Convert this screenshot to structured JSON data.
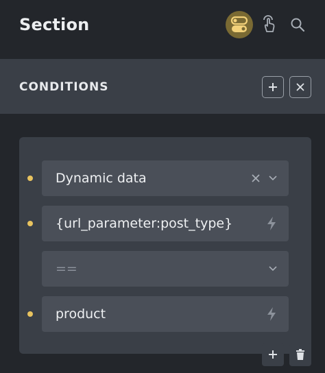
{
  "header": {
    "title": "Section",
    "icons": [
      "toggle-switch-icon",
      "pointer-hand-icon",
      "search-icon"
    ],
    "active_icon_color": "#7a6a33"
  },
  "conditions": {
    "label": "CONDITIONS"
  },
  "condition_rows": [
    {
      "value": "Dynamic data",
      "control": "select-with-clear"
    },
    {
      "value": "{url_parameter:post_type}",
      "control": "dynamic-data"
    },
    {
      "value": "==",
      "control": "select",
      "placeholder": true
    },
    {
      "value": "product",
      "control": "dynamic-data"
    }
  ],
  "colors": {
    "background": "#23262b",
    "panel": "#3a3f47",
    "field": "#4a4f58",
    "indicator_dot": "#e8c35f"
  }
}
